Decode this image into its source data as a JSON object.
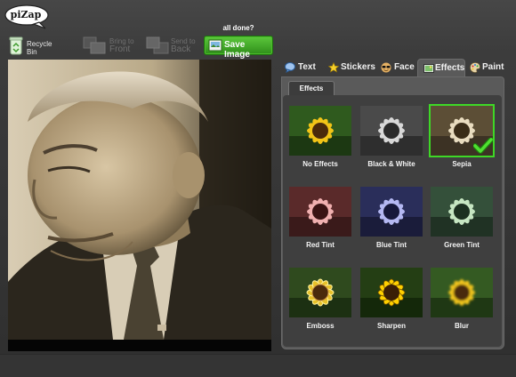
{
  "logo": {
    "text": "piZap"
  },
  "toolbar": {
    "recycle": {
      "line1": "Recycle",
      "line2": "Bin"
    },
    "bring_front": {
      "line1": "Bring to",
      "line2": "Front"
    },
    "send_back": {
      "line1": "Send to",
      "line2": "Back"
    },
    "all_done": "all done?",
    "save_label": "Save Image"
  },
  "tabs": [
    {
      "label": "Text",
      "icon": "speech-bubble-icon"
    },
    {
      "label": "Stickers",
      "icon": "star-icon"
    },
    {
      "label": "Face",
      "icon": "sunglasses-face-icon"
    },
    {
      "label": "Effects",
      "icon": "photo-effects-icon",
      "active": true
    },
    {
      "label": "Paint",
      "icon": "palette-icon"
    }
  ],
  "panel": {
    "subtab": "Effects",
    "effects": [
      {
        "label": "No Effects",
        "filter": "none"
      },
      {
        "label": "Black & White",
        "filter": "bw"
      },
      {
        "label": "Sepia",
        "filter": "sepia",
        "selected": true
      },
      {
        "label": "Red Tint",
        "filter": "red"
      },
      {
        "label": "Blue Tint",
        "filter": "blue"
      },
      {
        "label": "Green Tint",
        "filter": "green"
      },
      {
        "label": "Emboss",
        "filter": "emboss"
      },
      {
        "label": "Sharpen",
        "filter": "sharpen"
      },
      {
        "label": "Blur",
        "filter": "blur"
      }
    ]
  },
  "colors": {
    "save_button": "#3aa824",
    "selected_outline": "#3ed826",
    "sepia_tone": "#c9b48e"
  }
}
